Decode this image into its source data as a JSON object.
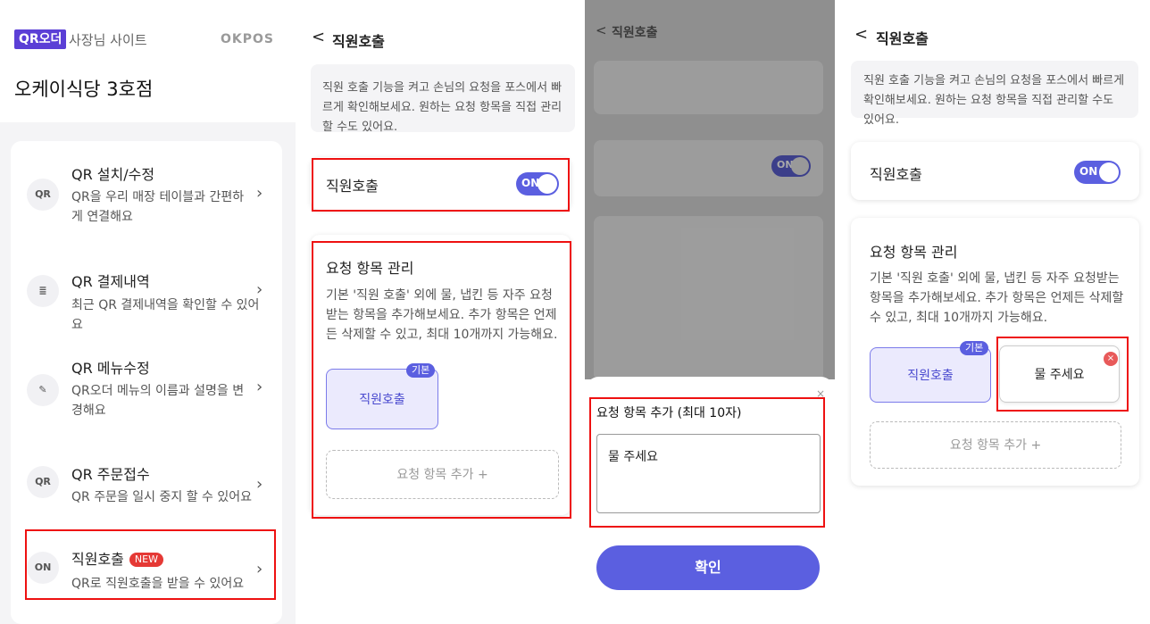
{
  "panel1": {
    "brand_badge": "QR오더",
    "brand_sub": "사장님 사이트",
    "partner": "OKPOS",
    "store_name": "오케이식당 3호점",
    "menu": [
      {
        "title": "QR 설치/수정",
        "desc": "QR을 우리 매장 테이블과 간편하게 연결해요",
        "icon": "qr-code-icon"
      },
      {
        "title": "QR 결제내역",
        "desc": "최근 QR 결제내역을 확인할 수 있어요",
        "icon": "receipt-icon"
      },
      {
        "title": "QR 메뉴수정",
        "desc": "QR오더 메뉴의 이름과 설명을 변경해요",
        "icon": "edit-menu-icon"
      },
      {
        "title": "QR 주문접수",
        "desc": "QR 주문을 일시 중지 할 수 있어요",
        "icon": "order-toggle-icon"
      },
      {
        "title": "직원호출",
        "badge": "NEW",
        "desc": "QR로 직원호출을 받을 수 있어요",
        "icon": "bell-icon"
      }
    ],
    "icon_glyphs": [
      "QR",
      "≣",
      "✎",
      "QR",
      "ON"
    ]
  },
  "screen": {
    "back": "<",
    "title": "직원호출",
    "info": "직원 호출 기능을 켜고 손님의 요청을 포스에서 빠르게 확인해보세요. 원하는 요청 항목을 직접 관리할 수도 있어요.",
    "toggle_label": "직원호출",
    "toggle_state": "ON",
    "section_title": "요청 항목 관리",
    "section_desc": "기본 '직원 호출' 외에 물, 냅킨 등 자주 요청받는 항목을 추가해보세요. 추가 항목은 언제든 삭제할 수 있고, 최대 10개까지 가능해요.",
    "default_tag": "기본",
    "default_item": "직원호출",
    "add_item": "요청 항목 추가 +"
  },
  "dialog": {
    "title": "요청 항목 추가 (최대 10자)",
    "close": "×",
    "input_value": "물 주세요",
    "confirm": "확인"
  },
  "added_item": "물 주세요",
  "remove_glyph": "×",
  "colors": {
    "accent": "#5b5fe0",
    "brand": "#5b3fd6",
    "highlight": "#e11111",
    "new_badge": "#e53935"
  }
}
